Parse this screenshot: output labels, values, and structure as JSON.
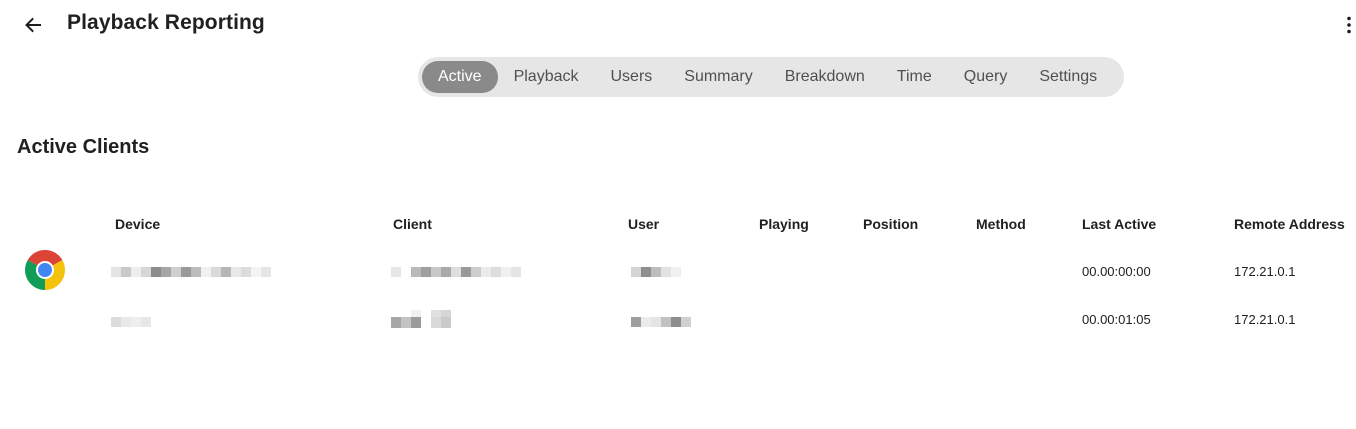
{
  "header": {
    "title": "Playback Reporting",
    "back_icon": "arrow-left-icon",
    "menu_icon": "more-vertical-icon"
  },
  "tabs": [
    {
      "label": "Active",
      "active": true
    },
    {
      "label": "Playback",
      "active": false
    },
    {
      "label": "Users",
      "active": false
    },
    {
      "label": "Summary",
      "active": false
    },
    {
      "label": "Breakdown",
      "active": false
    },
    {
      "label": "Time",
      "active": false
    },
    {
      "label": "Query",
      "active": false
    },
    {
      "label": "Settings",
      "active": false
    }
  ],
  "section": {
    "title": "Active Clients"
  },
  "table": {
    "columns": [
      "Device",
      "Client",
      "User",
      "Playing",
      "Position",
      "Method",
      "Last Active",
      "Remote Address"
    ],
    "rows": [
      {
        "icon": "chrome-icon",
        "device": "",
        "client": "",
        "user": "",
        "playing": "",
        "position": "",
        "method": "",
        "last_active": "00.00:00:00",
        "remote_address": "172.21.0.1"
      },
      {
        "icon": "",
        "device": "",
        "client": "",
        "user": "",
        "playing": "",
        "position": "",
        "method": "",
        "last_active": "00.00:01:05",
        "remote_address": "172.21.0.1"
      }
    ]
  },
  "colors": {
    "tab_active_bg": "#8a8a8a",
    "tab_bar_bg": "#e6e6e6",
    "text": "#202020"
  }
}
